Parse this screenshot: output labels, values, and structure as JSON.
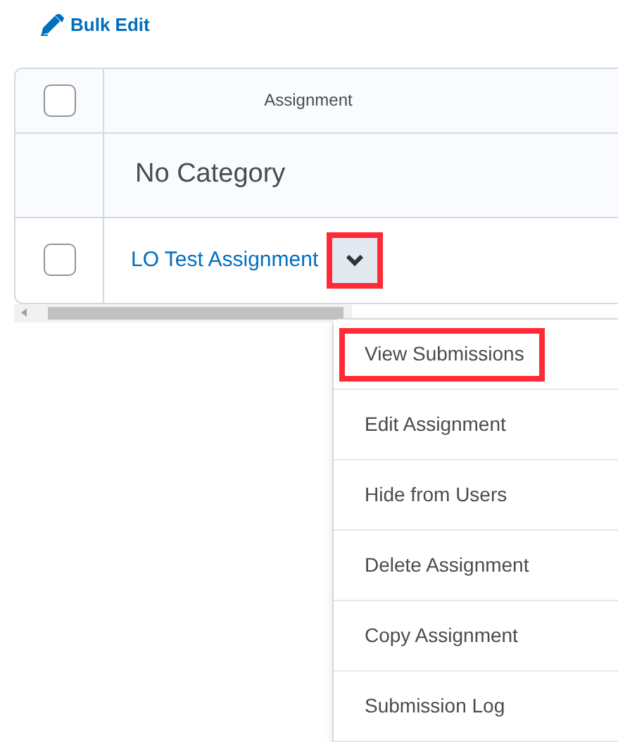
{
  "toolbar": {
    "bulk_edit": "Bulk Edit"
  },
  "table": {
    "header": {
      "checked": false,
      "column": "Assignment"
    },
    "category": "No Category",
    "rows": [
      {
        "checked": false,
        "title": "LO Test Assignment",
        "menu_highlighted": true
      }
    ]
  },
  "menu": {
    "items": [
      {
        "label": "View Submissions",
        "highlighted": true
      },
      {
        "label": "Edit Assignment",
        "highlighted": false
      },
      {
        "label": "Hide from Users",
        "highlighted": false
      },
      {
        "label": "Delete Assignment",
        "highlighted": false
      },
      {
        "label": "Copy Assignment",
        "highlighted": false
      },
      {
        "label": "Submission Log",
        "highlighted": false
      }
    ]
  }
}
